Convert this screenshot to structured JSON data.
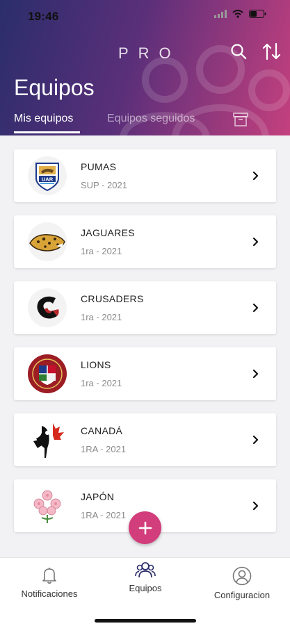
{
  "status_bar": {
    "time": "19:46"
  },
  "header": {
    "brand": "PRO",
    "title": "Equipos",
    "tabs": [
      {
        "label": "Mis equipos",
        "active": true
      },
      {
        "label": "Equipos seguidos",
        "active": false
      }
    ],
    "icons": [
      "search-icon",
      "sort-icon",
      "archive-icon"
    ]
  },
  "teams": [
    {
      "name": "PUMAS",
      "division": "SUP - 2021",
      "logo": "uar-shield-logo"
    },
    {
      "name": "JAGUARES",
      "division": "1ra - 2021",
      "logo": "jaguar-logo"
    },
    {
      "name": "CRUSADERS",
      "division": "1ra - 2021",
      "logo": "crusaders-logo"
    },
    {
      "name": "LIONS",
      "division": "1ra - 2021",
      "logo": "lions-crest-logo"
    },
    {
      "name": "CANADÁ",
      "division": "1RA - 2021",
      "logo": "canada-maple-logo"
    },
    {
      "name": "JAPÓN",
      "division": "1RA - 2021",
      "logo": "japan-cherry-blossom-logo"
    }
  ],
  "fab": {
    "icon": "plus-icon"
  },
  "bottom_nav": [
    {
      "label": "Notificaciones",
      "icon": "bell-icon"
    },
    {
      "label": "Equipos",
      "icon": "team-icon",
      "active": true
    },
    {
      "label": "Configuracion",
      "icon": "user-icon"
    }
  ],
  "colors": {
    "accent": "#d23d7b",
    "header_start": "#2b2e6b",
    "header_end": "#c4407e"
  }
}
